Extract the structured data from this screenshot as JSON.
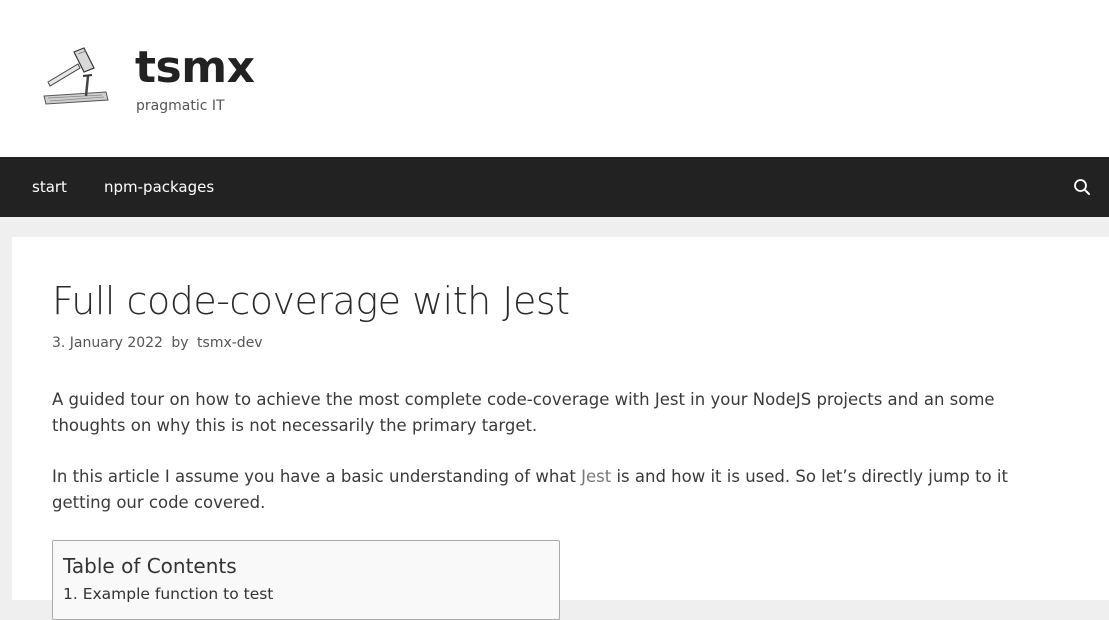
{
  "header": {
    "site_title": "tsmx",
    "tagline": "pragmatic IT",
    "logo_icon": "hammer-nail-icon"
  },
  "nav": {
    "items": [
      {
        "label": "start"
      },
      {
        "label": "npm-packages"
      }
    ],
    "search_icon": "search-icon"
  },
  "article": {
    "title": "Full code-coverage with Jest",
    "date": "3. January 2022",
    "by": "by",
    "author": "tsmx-dev",
    "intro": "A guided tour on how to achieve the most complete code-coverage with Jest in your NodeJS projects and an some thoughts on why this is not necessarily the primary target.",
    "para2_before": "In this article I assume you have a basic understanding of what ",
    "para2_link": "Jest",
    "para2_after": " is and how it is used. So let’s directly jump to it getting our code covered."
  },
  "toc": {
    "title": "Table of Contents",
    "items": [
      {
        "label": "1. Example function to test"
      }
    ]
  }
}
